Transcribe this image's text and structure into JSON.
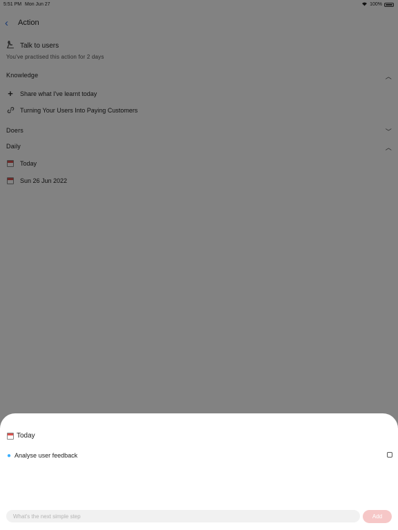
{
  "status_bar": {
    "time": "5:51 PM",
    "date": "Mon Jun 27",
    "battery": "100%"
  },
  "nav": {
    "title": "Action"
  },
  "action": {
    "title": "Talk to users",
    "practised_text": "You've practised this action for 2 days"
  },
  "sections": {
    "knowledge": {
      "label": "Knowledge",
      "expanded": true,
      "add_label": "Share what I've learnt today",
      "link_label": "Turning Your Users Into Paying Customers"
    },
    "doers": {
      "label": "Doers",
      "expanded": false
    },
    "daily": {
      "label": "Daily",
      "expanded": true,
      "items": [
        "Today",
        "Sun 26 Jun 2022"
      ]
    }
  },
  "sheet": {
    "title": "Today",
    "step": {
      "label": "Analyse user feedback",
      "checked": false
    },
    "input_placeholder": "What's the next simple step",
    "add_label": "Add"
  },
  "colors": {
    "accent": "#2f6fe4",
    "add_button": "#f6c7c7",
    "overlay": "rgba(0,0,0,0.49)"
  }
}
